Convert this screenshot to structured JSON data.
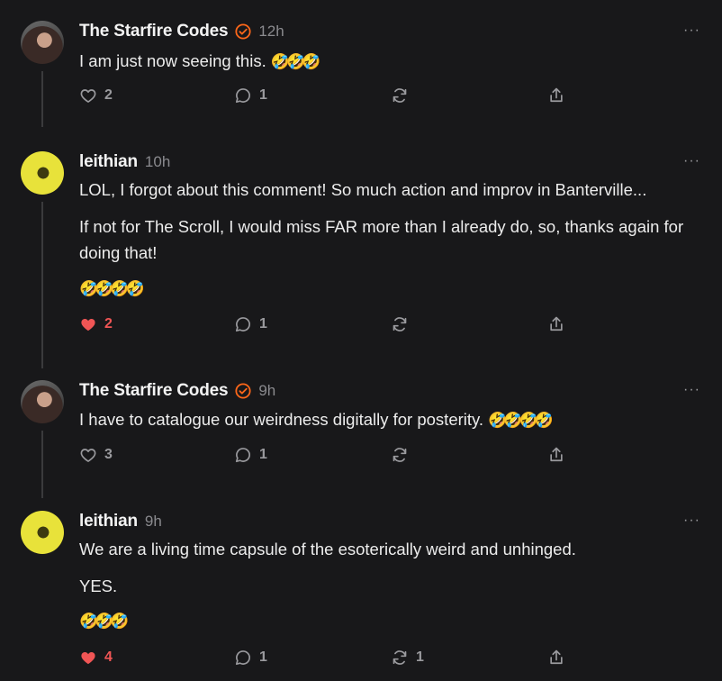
{
  "comments": [
    {
      "author": "The Starfire Codes",
      "verified": true,
      "time": "12h",
      "paragraphs": [
        "I am just now seeing this."
      ],
      "emoji_line": "",
      "trailing_emoji": "🤣🤣🤣",
      "likes": "2",
      "liked": false,
      "replies": "1",
      "restacks": ""
    },
    {
      "author": "leithian",
      "verified": false,
      "time": "10h",
      "paragraphs": [
        "LOL, I forgot about this comment! So much action and improv in Banterville...",
        "If not for The Scroll, I would miss FAR more than I already do, so, thanks again for doing that!"
      ],
      "emoji_line": "🤣🤣🤣🤣",
      "trailing_emoji": "",
      "likes": "2",
      "liked": true,
      "replies": "1",
      "restacks": ""
    },
    {
      "author": "The Starfire Codes",
      "verified": true,
      "time": "9h",
      "paragraphs": [
        "I have to catalogue our weirdness digitally for posterity."
      ],
      "emoji_line": "",
      "trailing_emoji": "🤣🤣🤣🤣",
      "likes": "3",
      "liked": false,
      "replies": "1",
      "restacks": ""
    },
    {
      "author": "leithian",
      "verified": false,
      "time": "9h",
      "paragraphs": [
        "We are a living time capsule of the esoterically weird and unhinged.",
        "YES."
      ],
      "emoji_line": "🤣🤣🤣",
      "trailing_emoji": "",
      "likes": "4",
      "liked": true,
      "replies": "1",
      "restacks": "1"
    }
  ],
  "more_label": "···",
  "colors": {
    "like_active": "#f05555",
    "verified": "#ff6719",
    "muted": "#9a9a9e",
    "background": "#18181a"
  },
  "icons": {
    "like": "heart-icon",
    "reply": "comment-bubble-icon",
    "restack": "restack-arrows-icon",
    "share": "share-upload-icon",
    "more": "ellipsis-icon"
  }
}
